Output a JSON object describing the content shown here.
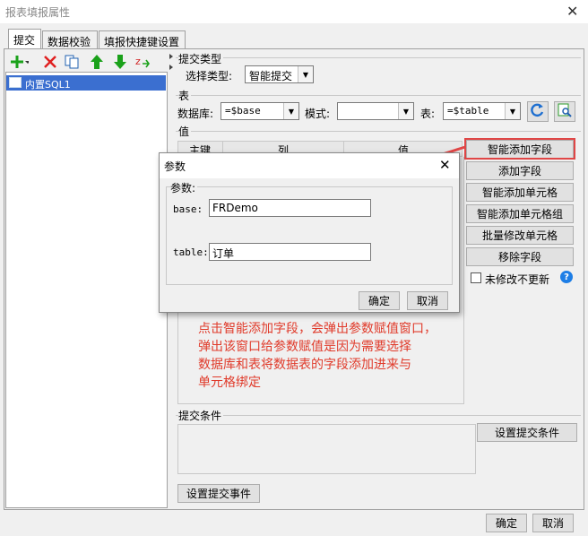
{
  "window": {
    "title": "报表填报属性",
    "close_glyph": "✕"
  },
  "tabs": [
    "提交",
    "数据校验",
    "填报快捷键设置"
  ],
  "toolbar": {
    "icons": [
      "add-icon",
      "delete-icon",
      "copy-icon",
      "move-up-icon",
      "move-down-icon",
      "sort-icon"
    ]
  },
  "left_list": {
    "items": [
      "内置SQL1"
    ]
  },
  "submit_type": {
    "group_label": "提交类型",
    "label": "选择类型:",
    "value": "智能提交"
  },
  "table_group": {
    "group_label": "表",
    "database_label": "数据库:",
    "database_value": "=$base",
    "mode_label": "模式:",
    "mode_value": "",
    "table_label": "表:",
    "table_value": "=$table"
  },
  "values": {
    "group_label": "值",
    "columns": [
      "主键",
      "列",
      "值"
    ],
    "buttons": [
      "智能添加字段",
      "添加字段",
      "智能添加单元格",
      "智能添加单元格组",
      "批量修改单元格",
      "移除字段"
    ],
    "no_update_label": "未修改不更新",
    "help_glyph": "?"
  },
  "annotation": {
    "lines": [
      "点击智能添加字段，会弹出参数赋值窗口，",
      "弹出该窗口给参数赋值是因为需要选择",
      "数据库和表将数据表的字段添加进来与",
      "单元格绑定"
    ],
    "color": "#e03a2a"
  },
  "param_dialog": {
    "title": "参数",
    "close_glyph": "✕",
    "group_label": "参数:",
    "params": [
      {
        "name": "base:",
        "value": "FRDemo"
      },
      {
        "name": "table:",
        "value": "订单"
      }
    ],
    "ok": "确定",
    "cancel": "取消"
  },
  "submit_condition": {
    "group_label": "提交条件",
    "button": "设置提交条件"
  },
  "submit_event_button": "设置提交事件",
  "footer": {
    "ok": "确定",
    "cancel": "取消"
  }
}
